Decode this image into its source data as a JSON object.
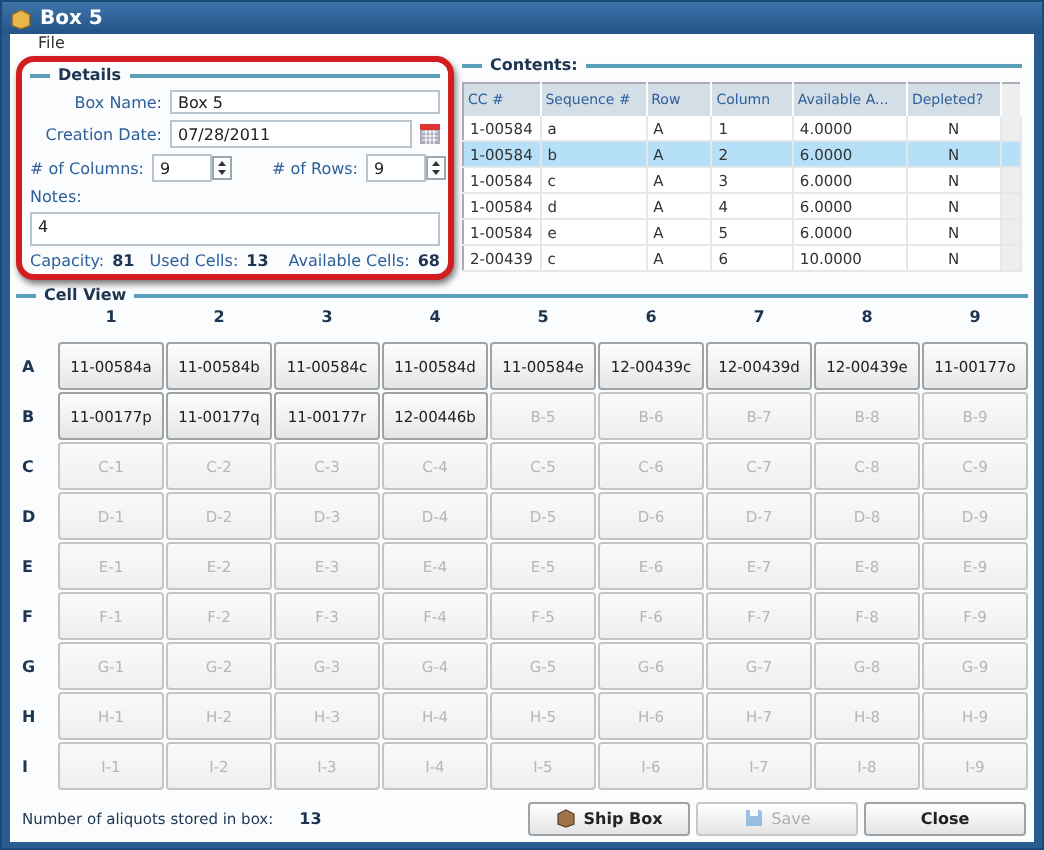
{
  "window": {
    "title": "Box 5"
  },
  "menu": [
    "File"
  ],
  "details": {
    "title": "Details",
    "box_name_label": "Box Name:",
    "box_name": "Box 5",
    "date_label": "Creation Date:",
    "date": "07/28/2011",
    "columns_label": "# of Columns:",
    "columns": "9",
    "rows_label": "# of Rows:",
    "rows": "9",
    "notes_label": "Notes:",
    "notes": "4",
    "capacity_label": "Capacity:",
    "capacity": "81",
    "used_label": "Used Cells:",
    "used": "13",
    "available_label": "Available Cells:",
    "available": "68"
  },
  "contents": {
    "title": "Contents:",
    "columns": [
      "CC #",
      "Sequence #",
      "Row",
      "Column",
      "Available A...",
      "Depleted?"
    ],
    "rows": [
      {
        "cells": [
          "1-00584",
          "a",
          "A",
          "1",
          "4.0000",
          "N"
        ],
        "selected": false
      },
      {
        "cells": [
          "1-00584",
          "b",
          "A",
          "2",
          "6.0000",
          "N"
        ],
        "selected": true
      },
      {
        "cells": [
          "1-00584",
          "c",
          "A",
          "3",
          "6.0000",
          "N"
        ],
        "selected": false
      },
      {
        "cells": [
          "1-00584",
          "d",
          "A",
          "4",
          "6.0000",
          "N"
        ],
        "selected": false
      },
      {
        "cells": [
          "1-00584",
          "e",
          "A",
          "5",
          "6.0000",
          "N"
        ],
        "selected": false
      },
      {
        "cells": [
          "2-00439",
          "c",
          "A",
          "6",
          "10.0000",
          "N"
        ],
        "selected": false
      }
    ]
  },
  "cell_view": {
    "title": "Cell View",
    "column_headers": [
      "1",
      "2",
      "3",
      "4",
      "5",
      "6",
      "7",
      "8",
      "9"
    ],
    "rows": [
      {
        "label": "A",
        "cells": [
          {
            "label": "11-00584a",
            "filled": true
          },
          {
            "label": "11-00584b",
            "filled": true
          },
          {
            "label": "11-00584c",
            "filled": true
          },
          {
            "label": "11-00584d",
            "filled": true
          },
          {
            "label": "11-00584e",
            "filled": true
          },
          {
            "label": "12-00439c",
            "filled": true
          },
          {
            "label": "12-00439d",
            "filled": true
          },
          {
            "label": "12-00439e",
            "filled": true
          },
          {
            "label": "11-00177o",
            "filled": true
          }
        ]
      },
      {
        "label": "B",
        "cells": [
          {
            "label": "11-00177p",
            "filled": true
          },
          {
            "label": "11-00177q",
            "filled": true
          },
          {
            "label": "11-00177r",
            "filled": true
          },
          {
            "label": "12-00446b",
            "filled": true
          },
          {
            "label": "B-5",
            "filled": false
          },
          {
            "label": "B-6",
            "filled": false
          },
          {
            "label": "B-7",
            "filled": false
          },
          {
            "label": "B-8",
            "filled": false
          },
          {
            "label": "B-9",
            "filled": false
          }
        ]
      },
      {
        "label": "C",
        "cells": [
          {
            "label": "C-1",
            "filled": false
          },
          {
            "label": "C-2",
            "filled": false
          },
          {
            "label": "C-3",
            "filled": false
          },
          {
            "label": "C-4",
            "filled": false
          },
          {
            "label": "C-5",
            "filled": false
          },
          {
            "label": "C-6",
            "filled": false
          },
          {
            "label": "C-7",
            "filled": false
          },
          {
            "label": "C-8",
            "filled": false
          },
          {
            "label": "C-9",
            "filled": false
          }
        ]
      },
      {
        "label": "D",
        "cells": [
          {
            "label": "D-1",
            "filled": false
          },
          {
            "label": "D-2",
            "filled": false
          },
          {
            "label": "D-3",
            "filled": false
          },
          {
            "label": "D-4",
            "filled": false
          },
          {
            "label": "D-5",
            "filled": false
          },
          {
            "label": "D-6",
            "filled": false
          },
          {
            "label": "D-7",
            "filled": false
          },
          {
            "label": "D-8",
            "filled": false
          },
          {
            "label": "D-9",
            "filled": false
          }
        ]
      },
      {
        "label": "E",
        "cells": [
          {
            "label": "E-1",
            "filled": false
          },
          {
            "label": "E-2",
            "filled": false
          },
          {
            "label": "E-3",
            "filled": false
          },
          {
            "label": "E-4",
            "filled": false
          },
          {
            "label": "E-5",
            "filled": false
          },
          {
            "label": "E-6",
            "filled": false
          },
          {
            "label": "E-7",
            "filled": false
          },
          {
            "label": "E-8",
            "filled": false
          },
          {
            "label": "E-9",
            "filled": false
          }
        ]
      },
      {
        "label": "F",
        "cells": [
          {
            "label": "F-1",
            "filled": false
          },
          {
            "label": "F-2",
            "filled": false
          },
          {
            "label": "F-3",
            "filled": false
          },
          {
            "label": "F-4",
            "filled": false
          },
          {
            "label": "F-5",
            "filled": false
          },
          {
            "label": "F-6",
            "filled": false
          },
          {
            "label": "F-7",
            "filled": false
          },
          {
            "label": "F-8",
            "filled": false
          },
          {
            "label": "F-9",
            "filled": false
          }
        ]
      },
      {
        "label": "G",
        "cells": [
          {
            "label": "G-1",
            "filled": false
          },
          {
            "label": "G-2",
            "filled": false
          },
          {
            "label": "G-3",
            "filled": false
          },
          {
            "label": "G-4",
            "filled": false
          },
          {
            "label": "G-5",
            "filled": false
          },
          {
            "label": "G-6",
            "filled": false
          },
          {
            "label": "G-7",
            "filled": false
          },
          {
            "label": "G-8",
            "filled": false
          },
          {
            "label": "G-9",
            "filled": false
          }
        ]
      },
      {
        "label": "H",
        "cells": [
          {
            "label": "H-1",
            "filled": false
          },
          {
            "label": "H-2",
            "filled": false
          },
          {
            "label": "H-3",
            "filled": false
          },
          {
            "label": "H-4",
            "filled": false
          },
          {
            "label": "H-5",
            "filled": false
          },
          {
            "label": "H-6",
            "filled": false
          },
          {
            "label": "H-7",
            "filled": false
          },
          {
            "label": "H-8",
            "filled": false
          },
          {
            "label": "H-9",
            "filled": false
          }
        ]
      },
      {
        "label": "I",
        "cells": [
          {
            "label": "I-1",
            "filled": false
          },
          {
            "label": "I-2",
            "filled": false
          },
          {
            "label": "I-3",
            "filled": false
          },
          {
            "label": "I-4",
            "filled": false
          },
          {
            "label": "I-5",
            "filled": false
          },
          {
            "label": "I-6",
            "filled": false
          },
          {
            "label": "I-7",
            "filled": false
          },
          {
            "label": "I-8",
            "filled": false
          },
          {
            "label": "I-9",
            "filled": false
          }
        ]
      }
    ]
  },
  "footer": {
    "aliquots_label": "Number of aliquots stored in box:",
    "aliquots": "13",
    "buttons": [
      {
        "label": "Ship Box",
        "kind": "ship",
        "disabled": false
      },
      {
        "label": "Save",
        "kind": "save",
        "disabled": true
      },
      {
        "label": "Close",
        "kind": "close",
        "disabled": false
      }
    ]
  }
}
